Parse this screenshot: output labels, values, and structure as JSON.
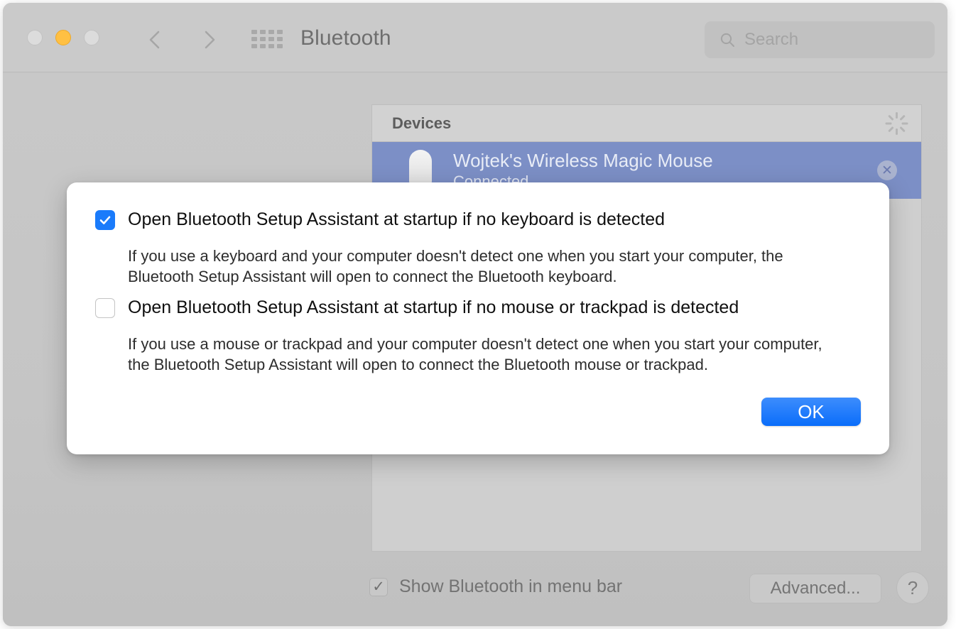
{
  "window": {
    "title": "Bluetooth",
    "traffic_lights": [
      "close",
      "minimize",
      "zoom"
    ],
    "nav_back_icon": "chevron-left-icon",
    "nav_forward_icon": "chevron-right-icon",
    "grid_icon": "show-all-grid-icon"
  },
  "search": {
    "placeholder": "Search",
    "icon": "search-icon",
    "value": ""
  },
  "left_panel": {
    "icon": "bluetooth-icon",
    "status_text": ""
  },
  "devices_panel": {
    "header": "Devices",
    "spinner_icon": "scanning-spinner-icon",
    "rows": [
      {
        "name": "Wojtek's Wireless Magic Mouse",
        "status": "Connected",
        "icon": "magic-mouse-icon",
        "disconnect_icon": "close-circle-icon",
        "selected": true
      }
    ]
  },
  "bottom_bar": {
    "show_in_menu_bar_label": "Show Bluetooth in menu bar",
    "show_in_menu_bar_checked": true,
    "checkmark": "✓",
    "advanced_label": "Advanced...",
    "help_label": "?"
  },
  "modal": {
    "options": [
      {
        "title": "Open Bluetooth Setup Assistant at startup if no keyboard is detected",
        "description": "If you use a keyboard and your computer doesn't detect one when you start your computer, the Bluetooth Setup Assistant will open to connect the Bluetooth keyboard.",
        "checked": true
      },
      {
        "title": "Open Bluetooth Setup Assistant at startup if no mouse or trackpad is detected",
        "description": "If you use a mouse or trackpad and your computer doesn't detect one when you start your computer, the Bluetooth Setup Assistant will open to connect the Bluetooth mouse or trackpad.",
        "checked": false
      }
    ],
    "ok_label": "OK"
  },
  "colors": {
    "accent_blue": "#1a7bfb",
    "ok_button_blue": "#0a6dfa",
    "selection_blue": "#7c8fc6",
    "window_chrome": "#cacaca",
    "bluetooth_tile": "#86b7d6",
    "minimize_amber": "#ffc043"
  }
}
